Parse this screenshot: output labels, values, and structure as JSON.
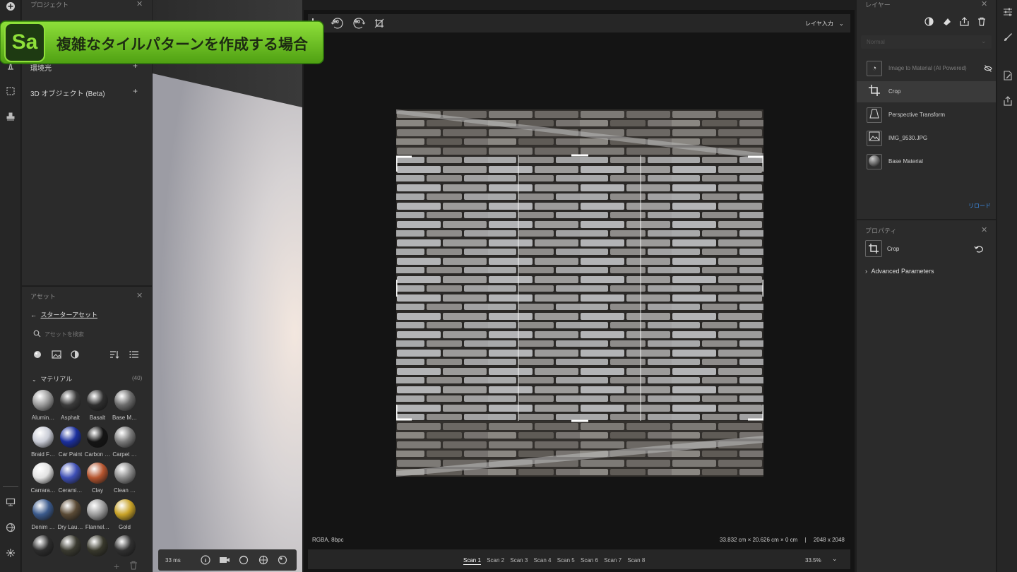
{
  "banner": {
    "app_badge": "Sa",
    "title": "複雑なタイルパターンを作成する場合"
  },
  "project_panel": {
    "title": "プロジェクト",
    "rows": [
      {
        "label": "環境光"
      },
      {
        "label": "3D オブジェクト (Beta)"
      }
    ]
  },
  "assets": {
    "title": "アセット",
    "back_label": "スターターアセット",
    "search_placeholder": "アセットを検索",
    "section_label": "マテリアル",
    "section_count": "(40)",
    "materials": [
      {
        "label": "Alumin…",
        "color": "#9a9a9a"
      },
      {
        "label": "Asphalt",
        "color": "#3a3a3a"
      },
      {
        "label": "Basalt",
        "color": "#2e2e2e"
      },
      {
        "label": "Base M…",
        "color": "#6c6c6c"
      },
      {
        "label": "Braid F…",
        "color": "#c9ccd6"
      },
      {
        "label": "Car Paint",
        "color": "#1b2f9e"
      },
      {
        "label": "Carbon …",
        "color": "#141414"
      },
      {
        "label": "Carpet …",
        "color": "#7a7a7a"
      },
      {
        "label": "Carrara…",
        "color": "#e2e2e2"
      },
      {
        "label": "Cerami…",
        "color": "#3e4fb5"
      },
      {
        "label": "Clay",
        "color": "#b5552f"
      },
      {
        "label": "Clean …",
        "color": "#8a8a8a"
      },
      {
        "label": "Denim …",
        "color": "#3b5a8c"
      },
      {
        "label": "Dry Lau…",
        "color": "#5a4a35"
      },
      {
        "label": "Flannel…",
        "color": "#9c9c9c"
      },
      {
        "label": "Gold",
        "color": "#c8a227"
      },
      {
        "label": "",
        "color": "#2c2c2c"
      },
      {
        "label": "",
        "color": "#3a3a30"
      },
      {
        "label": "",
        "color": "#38382c"
      },
      {
        "label": "",
        "color": "#303030"
      }
    ]
  },
  "viewport3d": {
    "timing": "33 ms"
  },
  "view2d": {
    "layer_input_label": "レイヤ入力",
    "status_left": "RGBA, 8bpc",
    "status_dims": "33.832 cm × 20.626 cm × 0 cm",
    "status_res": "2048 x 2048",
    "zoom": "33.5%",
    "scan_tabs": [
      "Scan 1",
      "Scan 2",
      "Scan 3",
      "Scan 4",
      "Scan 5",
      "Scan 6",
      "Scan 7",
      "Scan 8"
    ],
    "rotate_label_a": "90",
    "rotate_label_b": "90"
  },
  "layers": {
    "title": "レイヤー",
    "blend_mode": "Normal",
    "items": [
      {
        "label": "Image to Material (AI Powered)",
        "icon": "ai-material-icon"
      },
      {
        "label": "Crop",
        "icon": "crop-icon"
      },
      {
        "label": "Perspective Transform",
        "icon": "perspective-icon"
      },
      {
        "label": "IMG_9530.JPG",
        "icon": "image-icon"
      },
      {
        "label": "Base Material",
        "icon": "sphere-icon"
      }
    ],
    "reload_label": "リロード"
  },
  "properties": {
    "title": "プロパティ",
    "item_label": "Crop",
    "advanced_label": "Advanced Parameters"
  },
  "colors": {
    "accent_green": "#6ec21a",
    "badge_dark": "#1e3a12",
    "link_blue": "#3d8ee8"
  }
}
